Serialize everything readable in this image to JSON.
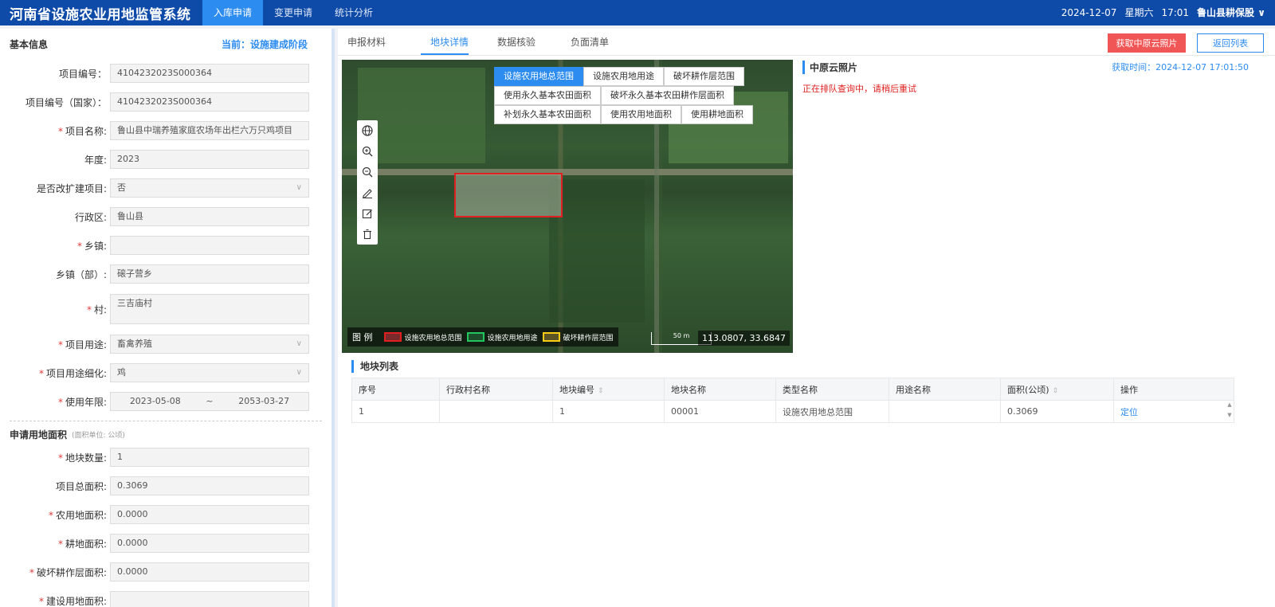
{
  "header": {
    "app_title": "河南省设施农业用地监管系统",
    "nav": [
      "入库申请",
      "变更申请",
      "统计分析"
    ],
    "active_nav": 0,
    "date": "2024-12-07",
    "weekday": "星期六",
    "time": "17:01",
    "user": "鲁山县耕保股",
    "user_icon": "chevron-down-icon"
  },
  "left": {
    "section_title": "基本信息",
    "stage": "当前：设施建成阶段",
    "fields": [
      {
        "label": "项目编号：",
        "value": "4104232023S000364",
        "required": false
      },
      {
        "label": "项目编号（国家）：",
        "value": "4104232023S000364",
        "required": false
      },
      {
        "label": "项目名称:",
        "value": "鲁山县中瑞养殖家庭农场年出栏六万只鸡项目",
        "required": true
      },
      {
        "label": "年度:",
        "value": "2023",
        "required": false
      },
      {
        "label": "是否改扩建项目:",
        "value": "否",
        "required": false,
        "select": true
      },
      {
        "label": "行政区:",
        "value": "鲁山县",
        "required": false
      },
      {
        "label": "乡镇:",
        "value": "",
        "required": true
      },
      {
        "label": "乡镇（部）:",
        "value": "磙子营乡",
        "required": false
      },
      {
        "label": "村:",
        "value": "三吉庙村",
        "required": true,
        "textarea": true
      },
      {
        "label": "项目用途:",
        "value": "畜禽养殖",
        "required": true,
        "select": true
      },
      {
        "label": "项目用途细化:",
        "value": "鸡",
        "required": true,
        "select": true
      }
    ],
    "use_period": {
      "label": "使用年限:",
      "start": "2023-05-08",
      "sep": "~",
      "end": "2053-03-27"
    },
    "section2_title": "申请用地面积",
    "section2_unit": "(面积单位: 公顷)",
    "area_fields": [
      {
        "label": "地块数量:",
        "value": "1",
        "required": true
      },
      {
        "label": "项目总面积:",
        "value": "0.3069",
        "required": false
      },
      {
        "label": "农用地面积:",
        "value": "0.0000",
        "required": true
      },
      {
        "label": "耕地面积:",
        "value": "0.0000",
        "required": true
      },
      {
        "label": "破坏耕作层面积:",
        "value": "0.0000",
        "required": true
      },
      {
        "label": "建设用地面积:",
        "value": "",
        "required": true
      }
    ]
  },
  "right": {
    "tabs": [
      "申报材料",
      "地块详情",
      "数据核验",
      "负面清单"
    ],
    "active_tab": 1,
    "btn_fetch": "获取中原云照片",
    "btn_back": "返回列表",
    "layers": [
      [
        "设施农用地总范围",
        "设施农用地用途",
        "破坏耕作层范围"
      ],
      [
        "使用永久基本农田面积",
        "破坏永久基本农田耕作层面积"
      ],
      [
        "补划永久基本农田面积",
        "使用农用地面积",
        "使用耕地面积"
      ]
    ],
    "tools": [
      "globe-icon",
      "zoom-in-icon",
      "zoom-out-icon",
      "pencil-icon",
      "edit-icon",
      "trash-icon"
    ],
    "legend": {
      "title": "图 例",
      "items": [
        {
          "label": "设施农用地总范围",
          "color": "#e02020"
        },
        {
          "label": "设施农用地用途",
          "color": "#22c55e"
        },
        {
          "label": "破坏耕作层范围",
          "color": "#facc15"
        }
      ]
    },
    "scale": "50 m",
    "coords": "113.0807, 33.6847",
    "cloud": {
      "title": "中原云照片",
      "time": "获取时间：2024-12-07 17:01:50",
      "msg": "正在排队查询中，请稍后重试"
    },
    "list_title": "地块列表",
    "table": {
      "headers": [
        "序号",
        "行政村名称",
        "地块编号",
        "地块名称",
        "类型名称",
        "用途名称",
        "面积(公顷)",
        "操作"
      ],
      "rows": [
        [
          "1",
          "",
          "1",
          "00001",
          "设施农用地总范围",
          "",
          "0.3069",
          "定位"
        ]
      ]
    }
  }
}
